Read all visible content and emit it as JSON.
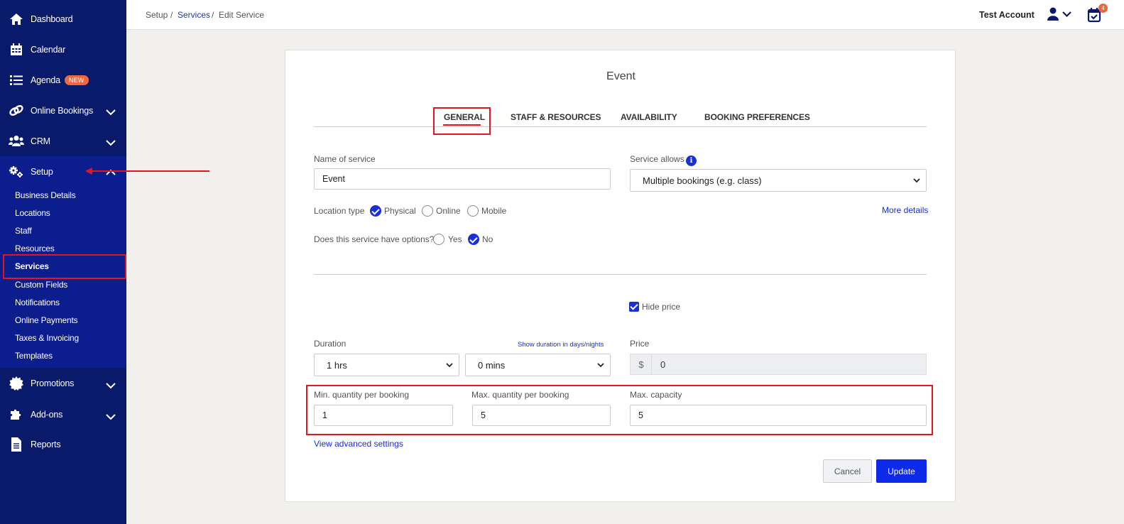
{
  "sidebar": {
    "items": [
      {
        "label": "Dashboard",
        "icon": "home-icon"
      },
      {
        "label": "Calendar",
        "icon": "calendar-icon"
      },
      {
        "label": "Agenda",
        "icon": "list-icon",
        "badge": "NEW"
      },
      {
        "label": "Online Bookings",
        "icon": "link-icon"
      },
      {
        "label": "CRM",
        "icon": "users-icon"
      },
      {
        "label": "Setup",
        "icon": "gears-icon"
      },
      {
        "label": "Promotions",
        "icon": "badge-icon"
      },
      {
        "label": "Add-ons",
        "icon": "puzzle-icon"
      },
      {
        "label": "Reports",
        "icon": "file-icon"
      }
    ],
    "setup_sub": [
      "Business Details",
      "Locations",
      "Staff",
      "Resources",
      "Services",
      "Custom Fields",
      "Notifications",
      "Online Payments",
      "Taxes & Invoicing",
      "Templates"
    ],
    "active_sub": "Services"
  },
  "breadcrumb": [
    "Setup",
    "Services",
    "Edit Service"
  ],
  "breadcrumb_sep": "/",
  "header": {
    "account": "Test Account",
    "notifications_count": "4"
  },
  "card": {
    "title": "Event",
    "tabs": [
      "GENERAL",
      "STAFF & RESOURCES",
      "AVAILABILITY",
      "BOOKING PREFERENCES"
    ],
    "active_tab": "GENERAL",
    "name_label": "Name of service",
    "name_value": "Event",
    "allows_label": "Service allows",
    "allows_value": "Multiple bookings (e.g. class)",
    "location_label": "Location type",
    "location_options": [
      "Physical",
      "Online",
      "Mobile"
    ],
    "location_selected": "Physical",
    "more_details": "More details",
    "options_label": "Does this service have options?",
    "options_choices": [
      "Yes",
      "No"
    ],
    "options_selected": "No",
    "hide_price_label": "Hide price",
    "hide_price_checked": true,
    "duration_label": "Duration",
    "duration_link": "Show duration in days/nights",
    "duration_hours": "1 hrs",
    "duration_mins": "0 mins",
    "price_label": "Price",
    "price_currency": "$",
    "price_value": "0",
    "min_qty_label": "Min. quantity per booking",
    "min_qty_value": "1",
    "max_qty_label": "Max. quantity per booking",
    "max_qty_value": "5",
    "max_cap_label": "Max. capacity",
    "max_cap_value": "5",
    "advanced_link": "View advanced settings",
    "cancel": "Cancel",
    "update": "Update"
  },
  "colors": {
    "sidebar": "#0a1a6b",
    "sidebar_active": "#0c1e8e",
    "accent": "#0d2ae8",
    "highlight": "#e3161d",
    "badge": "#f0673e"
  }
}
